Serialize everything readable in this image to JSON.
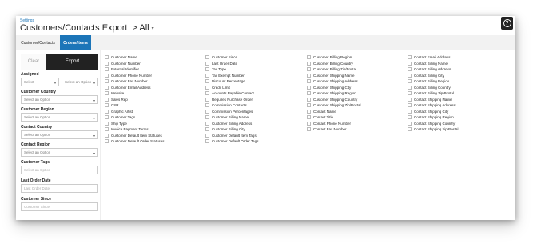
{
  "header": {
    "breadcrumb": "Settings",
    "title": "Customers/Contacts Export",
    "filter_label": "> All",
    "help_icon": "question-circle-icon"
  },
  "tabs": [
    {
      "label": "Customer/Contacts",
      "active": false
    },
    {
      "label": "Orders/Items",
      "active": true
    }
  ],
  "colors": {
    "accent": "#1c75b8",
    "dark": "#222222"
  },
  "sidebar": {
    "clear_label": "Clear",
    "export_label": "Export",
    "assigned_label": "Assigned",
    "assigned_select_value": "Select",
    "assigned_option_placeholder": "Select an Option",
    "customer_country_label": "Customer Country",
    "customer_country_placeholder": "Select an Option",
    "customer_region_label": "Customer Region",
    "customer_region_placeholder": "Select an Option",
    "contact_country_label": "Contact Country",
    "contact_country_placeholder": "Select an Option",
    "contact_region_label": "Contact Region",
    "contact_region_placeholder": "Select an Option",
    "customer_tags_label": "Customer Tags",
    "customer_tags_placeholder": "Select an Option",
    "last_order_date_label": "Last Order Date",
    "last_order_date_placeholder": "Last Order Date",
    "customer_since_label": "Customer Since",
    "customer_since_placeholder": "Customer Since"
  },
  "fields": {
    "col1": [
      "Customer Name",
      "Customer Number",
      "External Identifier",
      "Customer Phone Number",
      "Customer Fax Number",
      "Customer Email Address",
      "Website",
      "Sales Rep",
      "CSR",
      "Graphic Artist",
      "Customer Tags",
      "Ship Type",
      "Invoice Payment Terms",
      "Customer Default Item Statuses",
      "Customer Default Order Statuses"
    ],
    "col2": [
      "Customer Since",
      "Last Order Date",
      "Tax Type",
      "Tax Exempt Number",
      "Discount Percentage",
      "Credit Limit",
      "Accounts Payable Contact",
      "Requires Purchase Order",
      "Commission Contacts",
      "Commission Percentages",
      "Customer Billing Name",
      "Customer Billing Address",
      "Customer Billing City",
      "Customer Default Item Tags",
      "Customer Default Order Tags"
    ],
    "col3": [
      "Customer Billing Region",
      "Customer Billing Country",
      "Customer Billing Zip/Postal",
      "Customer Shipping Name",
      "Customer Shipping Address",
      "Customer Shipping City",
      "Customer Shipping Region",
      "Customer Shipping Country",
      "Customer Shipping Zip/Postal",
      "Contact Name",
      "Contact Title",
      "Contact Phone Number",
      "Contact Fax Number"
    ],
    "col4": [
      "Contact Email Address",
      "Contact Billing Name",
      "Contact Billing Address",
      "Contact Billing City",
      "Contact Billing Region",
      "Contact Billing Country",
      "Contact Billing Zip/Postal",
      "Contact Shipping Name",
      "Contact Shipping Address",
      "Contact Shipping City",
      "Contact Shipping Region",
      "Contact Shipping Country",
      "Contact Shipping Zip/Postal"
    ]
  }
}
